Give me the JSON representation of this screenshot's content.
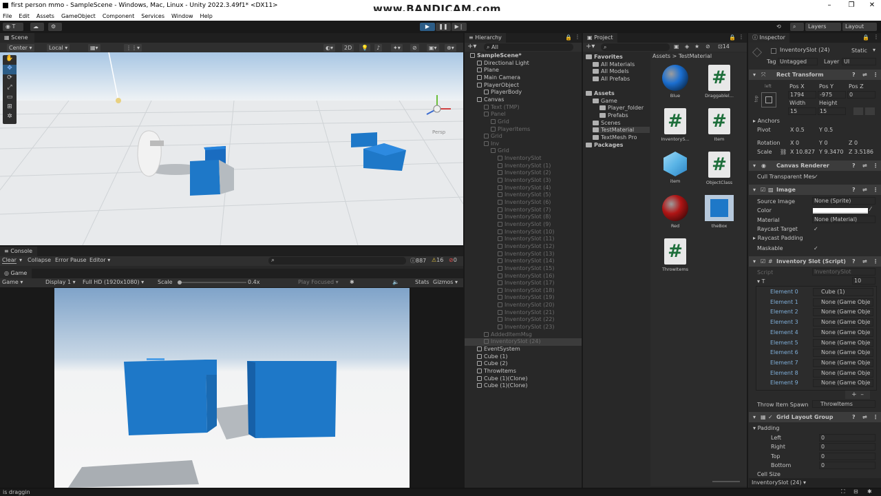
{
  "window": {
    "title": "first person mmo - SampleScene - Windows, Mac, Linux - Unity 2022.3.49f1* <DX11>",
    "watermark": "www.BANDICAM.com",
    "min": "–",
    "max": "❐",
    "close": "✕"
  },
  "menu": [
    "File",
    "Edit",
    "Assets",
    "GameObject",
    "Component",
    "Services",
    "Window",
    "Help"
  ],
  "toolbar": {
    "account": "T",
    "layers": "Layers",
    "layout": "Layout"
  },
  "scene": {
    "tab": "Scene",
    "pivot": "Center",
    "space": "Local",
    "mode2d": "2D",
    "persp": "Persp"
  },
  "console": {
    "tab": "Console",
    "clear": "Clear",
    "collapse": "Collapse",
    "error_pause": "Error Pause",
    "editor": "Editor",
    "logs": "887",
    "warnings": "16",
    "errors": "0"
  },
  "game": {
    "tab": "Game",
    "mode": "Game",
    "display": "Display 1",
    "resolution": "Full HD (1920x1080)",
    "scale_label": "Scale",
    "scale_value": "0.4x",
    "play_focused": "Play Focused",
    "stats": "Stats",
    "gizmos": "Gizmos"
  },
  "hierarchy": {
    "tab": "Hierarchy",
    "search": "All",
    "items": [
      {
        "label": "SampleScene*",
        "indent": 0,
        "dim": false,
        "bold": true
      },
      {
        "label": "Directional Light",
        "indent": 1,
        "dim": false
      },
      {
        "label": "Plane",
        "indent": 1,
        "dim": false
      },
      {
        "label": "Main Camera",
        "indent": 1,
        "dim": false
      },
      {
        "label": "PlayerObject",
        "indent": 1,
        "dim": false
      },
      {
        "label": "PlayerBody",
        "indent": 2,
        "dim": false
      },
      {
        "label": "Canvas",
        "indent": 1,
        "dim": false
      },
      {
        "label": "Text (TMP)",
        "indent": 2,
        "dim": true
      },
      {
        "label": "Panel",
        "indent": 2,
        "dim": true
      },
      {
        "label": "Grid",
        "indent": 3,
        "dim": true
      },
      {
        "label": "PlayerItems",
        "indent": 3,
        "dim": true
      },
      {
        "label": "Grid",
        "indent": 2,
        "dim": true
      },
      {
        "label": "Inv",
        "indent": 2,
        "dim": true
      },
      {
        "label": "Grid",
        "indent": 3,
        "dim": true
      },
      {
        "label": "InventorySlot",
        "indent": 4,
        "dim": true
      },
      {
        "label": "InventorySlot (1)",
        "indent": 4,
        "dim": true
      },
      {
        "label": "InventorySlot (2)",
        "indent": 4,
        "dim": true
      },
      {
        "label": "InventorySlot (3)",
        "indent": 4,
        "dim": true
      },
      {
        "label": "InventorySlot (4)",
        "indent": 4,
        "dim": true
      },
      {
        "label": "InventorySlot (5)",
        "indent": 4,
        "dim": true
      },
      {
        "label": "InventorySlot (6)",
        "indent": 4,
        "dim": true
      },
      {
        "label": "InventorySlot (7)",
        "indent": 4,
        "dim": true
      },
      {
        "label": "InventorySlot (8)",
        "indent": 4,
        "dim": true
      },
      {
        "label": "InventorySlot (9)",
        "indent": 4,
        "dim": true
      },
      {
        "label": "InventorySlot (10)",
        "indent": 4,
        "dim": true
      },
      {
        "label": "InventorySlot (11)",
        "indent": 4,
        "dim": true
      },
      {
        "label": "InventorySlot (12)",
        "indent": 4,
        "dim": true
      },
      {
        "label": "InventorySlot (13)",
        "indent": 4,
        "dim": true
      },
      {
        "label": "InventorySlot (14)",
        "indent": 4,
        "dim": true
      },
      {
        "label": "InventorySlot (15)",
        "indent": 4,
        "dim": true
      },
      {
        "label": "InventorySlot (16)",
        "indent": 4,
        "dim": true
      },
      {
        "label": "InventorySlot (17)",
        "indent": 4,
        "dim": true
      },
      {
        "label": "InventorySlot (18)",
        "indent": 4,
        "dim": true
      },
      {
        "label": "InventorySlot (19)",
        "indent": 4,
        "dim": true
      },
      {
        "label": "InventorySlot (20)",
        "indent": 4,
        "dim": true
      },
      {
        "label": "InventorySlot (21)",
        "indent": 4,
        "dim": true
      },
      {
        "label": "InventorySlot (22)",
        "indent": 4,
        "dim": true
      },
      {
        "label": "InventorySlot (23)",
        "indent": 4,
        "dim": true
      },
      {
        "label": "AddedItemMsg",
        "indent": 2,
        "dim": true
      },
      {
        "label": "InventorySlot (24)",
        "indent": 2,
        "dim": true,
        "selected": true
      },
      {
        "label": "EventSystem",
        "indent": 1,
        "dim": false
      },
      {
        "label": "Cube (1)",
        "indent": 1,
        "dim": false
      },
      {
        "label": "Cube (2)",
        "indent": 1,
        "dim": false
      },
      {
        "label": "ThrowItems",
        "indent": 1,
        "dim": false
      },
      {
        "label": "Cube (1)(Clone)",
        "indent": 1,
        "dim": false
      },
      {
        "label": "Cube (1)(Clone)",
        "indent": 1,
        "dim": false
      }
    ]
  },
  "project": {
    "tab": "Project",
    "count": "14",
    "breadcrumb": "Assets > TestMaterial",
    "tree": [
      {
        "label": "Favorites",
        "indent": 0,
        "bold": true
      },
      {
        "label": "All Materials",
        "indent": 1
      },
      {
        "label": "All Models",
        "indent": 1
      },
      {
        "label": "All Prefabs",
        "indent": 1
      },
      {
        "label": "Assets",
        "indent": 0,
        "bold": true
      },
      {
        "label": "Game",
        "indent": 1
      },
      {
        "label": "Player_folder",
        "indent": 2
      },
      {
        "label": "Prefabs",
        "indent": 2
      },
      {
        "label": "Scenes",
        "indent": 1
      },
      {
        "label": "TestMaterial",
        "indent": 1,
        "selected": true
      },
      {
        "label": "TextMesh Pro",
        "indent": 1
      },
      {
        "label": "Packages",
        "indent": 0,
        "bold": true
      }
    ],
    "assets": [
      {
        "label": "Blue",
        "kind": "sphere",
        "color": "#1b6fd1"
      },
      {
        "label": "Draggablel...",
        "kind": "script"
      },
      {
        "label": "InventoryS...",
        "kind": "script"
      },
      {
        "label": "Item",
        "kind": "script"
      },
      {
        "label": "item",
        "kind": "cube"
      },
      {
        "label": "ObjectClass",
        "kind": "script"
      },
      {
        "label": "Red",
        "kind": "sphere",
        "color": "#b01515"
      },
      {
        "label": "theBox",
        "kind": "prefab"
      },
      {
        "label": "ThrowItems",
        "kind": "script"
      }
    ]
  },
  "inspector": {
    "tab": "Inspector",
    "name": "InventorySlot (24)",
    "static": "Static",
    "tag_label": "Tag",
    "tag": "Untagged",
    "layer_label": "Layer",
    "layer": "UI",
    "rect": {
      "title": "Rect Transform",
      "anchor_preset": "left",
      "side": "top",
      "posx_l": "Pos X",
      "posy_l": "Pos Y",
      "posz_l": "Pos Z",
      "posx": "1794",
      "posy": "-975",
      "posz": "0",
      "w_l": "Width",
      "h_l": "Height",
      "w": "15",
      "h": "15",
      "anchors": "Anchors",
      "pivot": "Pivot",
      "pivot_x": "0.5",
      "pivot_y": "0.5",
      "rotation": "Rotation",
      "rot_x": "0",
      "rot_y": "0",
      "rot_z": "0",
      "scale": "Scale",
      "sc_x": "10.827",
      "sc_y": "9.3470",
      "sc_z": "3.5186"
    },
    "canvas_renderer": {
      "title": "Canvas Renderer",
      "cull": "Cull Transparent Mes"
    },
    "image": {
      "title": "Image",
      "source_l": "Source Image",
      "source": "None (Sprite)",
      "color_l": "Color",
      "material_l": "Material",
      "material": "None (Material)",
      "raycast_target": "Raycast Target",
      "raycast_padding": "Raycast Padding",
      "maskable": "Maskable"
    },
    "script": {
      "title": "Inventory Slot (Script)",
      "script_l": "Script",
      "script": "InventorySlot",
      "t_label": "T",
      "t_count": "10",
      "elements": [
        {
          "label": "Element 0",
          "value": "Cube (1)"
        },
        {
          "label": "Element 1",
          "value": "None (Game Obje"
        },
        {
          "label": "Element 2",
          "value": "None (Game Obje"
        },
        {
          "label": "Element 3",
          "value": "None (Game Obje"
        },
        {
          "label": "Element 4",
          "value": "None (Game Obje"
        },
        {
          "label": "Element 5",
          "value": "None (Game Obje"
        },
        {
          "label": "Element 6",
          "value": "None (Game Obje"
        },
        {
          "label": "Element 7",
          "value": "None (Game Obje"
        },
        {
          "label": "Element 8",
          "value": "None (Game Obje"
        },
        {
          "label": "Element 9",
          "value": "None (Game Obje"
        }
      ],
      "throw_l": "Throw Item Spawn",
      "throw": "ThrowItems"
    },
    "grid": {
      "title": "Grid Layout Group",
      "padding": "Padding",
      "left_l": "Left",
      "right_l": "Right",
      "top_l": "Top",
      "bottom_l": "Bottom",
      "left": "0",
      "right": "0",
      "top": "0",
      "bottom": "0",
      "cell_size": "Cell Size"
    },
    "footer": "InventorySlot (24)"
  },
  "status": {
    "text": "is draggin"
  },
  "colors": {
    "accent": "#2c5d87",
    "cube": "#1e78c8",
    "sky_top": "#8fb4d9",
    "ground": "#e6e8ea"
  }
}
